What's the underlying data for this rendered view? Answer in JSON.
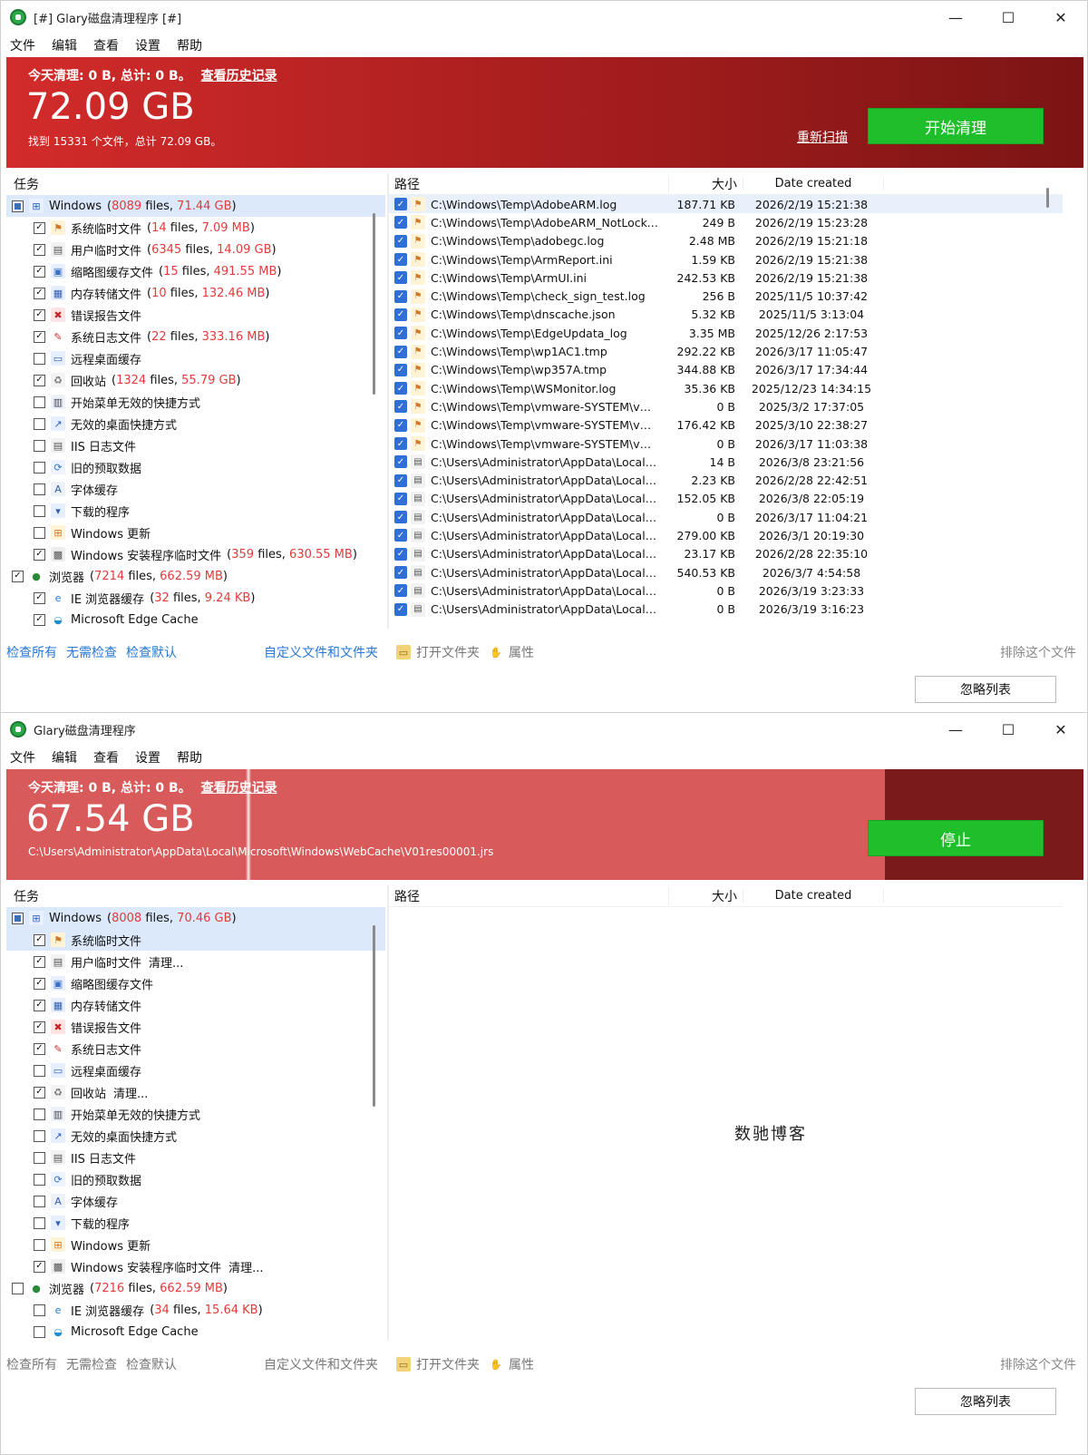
{
  "menu": [
    "文件",
    "编辑",
    "查看",
    "设置",
    "帮助"
  ],
  "window1": {
    "title": "[#] Glary磁盘清理程序 [#]",
    "banner": {
      "today": "今天清理: 0 B, 总计: 0 B。",
      "history": "查看历史记录",
      "big": "72.09 GB",
      "sub": "找到 15331 个文件，总计 72.09 GB。",
      "rescan": "重新扫描",
      "action": "开始清理"
    },
    "tasks_header": "任务",
    "tree": [
      {
        "check": "tri",
        "name": "Windows",
        "files": "8089",
        "size": "71.44 GB",
        "level": 0,
        "icon": "windows-icon",
        "sel": true
      },
      {
        "check": "on",
        "name": "系统临时文件",
        "files": "14",
        "size": "7.09 MB",
        "level": 1,
        "icon": "windows-flag-icon"
      },
      {
        "check": "on",
        "name": "用户临时文件",
        "files": "6345",
        "size": "14.09 GB",
        "level": 1,
        "icon": "user-file-icon"
      },
      {
        "check": "on",
        "name": "缩略图缓存文件",
        "files": "15",
        "size": "491.55 MB",
        "level": 1,
        "icon": "thumbnail-icon"
      },
      {
        "check": "on",
        "name": "内存转储文件",
        "files": "10",
        "size": "132.46 MB",
        "level": 1,
        "icon": "memory-dump-icon"
      },
      {
        "check": "on",
        "name": "错误报告文件",
        "files": "",
        "size": "",
        "level": 1,
        "icon": "error-report-icon"
      },
      {
        "check": "on",
        "name": "系统日志文件",
        "files": "22",
        "size": "333.16 MB",
        "level": 1,
        "icon": "system-log-icon"
      },
      {
        "check": "off",
        "name": "远程桌面缓存",
        "files": "",
        "size": "",
        "level": 1,
        "icon": "remote-desktop-icon"
      },
      {
        "check": "on",
        "name": "回收站",
        "files": "1324",
        "size": "55.79 GB",
        "level": 1,
        "icon": "recycle-bin-icon"
      },
      {
        "check": "off",
        "name": "开始菜单无效的快捷方式",
        "files": "",
        "size": "",
        "level": 1,
        "icon": "start-menu-icon"
      },
      {
        "check": "off",
        "name": "无效的桌面快捷方式",
        "files": "",
        "size": "",
        "level": 1,
        "icon": "desktop-shortcut-icon"
      },
      {
        "check": "off",
        "name": "IIS 日志文件",
        "files": "",
        "size": "",
        "level": 1,
        "icon": "iis-log-icon"
      },
      {
        "check": "off",
        "name": "旧的预取数据",
        "files": "",
        "size": "",
        "level": 1,
        "icon": "prefetch-icon"
      },
      {
        "check": "off",
        "name": "字体缓存",
        "files": "",
        "size": "",
        "level": 1,
        "icon": "font-cache-icon"
      },
      {
        "check": "off",
        "name": "下载的程序",
        "files": "",
        "size": "",
        "level": 1,
        "icon": "downloaded-program-icon"
      },
      {
        "check": "off",
        "name": "Windows 更新",
        "files": "",
        "size": "",
        "level": 1,
        "icon": "windows-update-icon"
      },
      {
        "check": "on",
        "name": "Windows 安装程序临时文件",
        "files": "359",
        "size": "630.55 MB",
        "level": 1,
        "icon": "installer-temp-icon"
      },
      {
        "check": "on",
        "name": "浏览器",
        "files": "7214",
        "size": "662.59 MB",
        "level": 0,
        "icon": "globe-icon"
      },
      {
        "check": "on",
        "name": "IE 浏览器缓存",
        "files": "32",
        "size": "9.24 KB",
        "level": 1,
        "icon": "ie-icon"
      },
      {
        "check": "on",
        "name": "Microsoft Edge Cache",
        "files": "",
        "size": "",
        "level": 1,
        "icon": "edge-icon"
      }
    ],
    "columns": {
      "path": "路径",
      "size": "大小",
      "date": "Date created"
    },
    "files": [
      {
        "path": "C:\\Windows\\Temp\\AdobeARM.log",
        "size": "187.71 KB",
        "date": "2026/2/19 15:21:38",
        "icon": "windows-flag-icon"
      },
      {
        "path": "C:\\Windows\\Temp\\AdobeARM_NotLocke...",
        "size": "249 B",
        "date": "2026/2/19 15:23:28",
        "icon": "windows-flag-icon"
      },
      {
        "path": "C:\\Windows\\Temp\\adobegc.log",
        "size": "2.48 MB",
        "date": "2026/2/19 15:21:18",
        "icon": "windows-flag-icon"
      },
      {
        "path": "C:\\Windows\\Temp\\ArmReport.ini",
        "size": "1.59 KB",
        "date": "2026/2/19 15:21:38",
        "icon": "windows-flag-icon"
      },
      {
        "path": "C:\\Windows\\Temp\\ArmUI.ini",
        "size": "242.53 KB",
        "date": "2026/2/19 15:21:38",
        "icon": "windows-flag-icon"
      },
      {
        "path": "C:\\Windows\\Temp\\check_sign_test.log",
        "size": "256 B",
        "date": "2025/11/5 10:37:42",
        "icon": "windows-flag-icon"
      },
      {
        "path": "C:\\Windows\\Temp\\dnscache.json",
        "size": "5.32 KB",
        "date": "2025/11/5 3:13:04",
        "icon": "windows-flag-icon"
      },
      {
        "path": "C:\\Windows\\Temp\\EdgeUpdata_log",
        "size": "3.35 MB",
        "date": "2025/12/26 2:17:53",
        "icon": "windows-flag-icon"
      },
      {
        "path": "C:\\Windows\\Temp\\wp1AC1.tmp",
        "size": "292.22 KB",
        "date": "2026/3/17 11:05:47",
        "icon": "windows-flag-icon"
      },
      {
        "path": "C:\\Windows\\Temp\\wp357A.tmp",
        "size": "344.88 KB",
        "date": "2026/3/17 17:34:44",
        "icon": "windows-flag-icon"
      },
      {
        "path": "C:\\Windows\\Temp\\WSMonitor.log",
        "size": "35.36 KB",
        "date": "2025/12/23 14:34:15",
        "icon": "windows-flag-icon"
      },
      {
        "path": "C:\\Windows\\Temp\\vmware-SYSTEM\\vma...",
        "size": "0 B",
        "date": "2025/3/2 17:37:05",
        "icon": "windows-flag-icon"
      },
      {
        "path": "C:\\Windows\\Temp\\vmware-SYSTEM\\vmw...",
        "size": "176.42 KB",
        "date": "2025/3/10 22:38:27",
        "icon": "windows-flag-icon"
      },
      {
        "path": "C:\\Windows\\Temp\\vmware-SYSTEM\\vmw...",
        "size": "0 B",
        "date": "2026/3/17 11:03:38",
        "icon": "windows-flag-icon"
      },
      {
        "path": "C:\\Users\\Administrator\\AppData\\Local\\T...",
        "size": "14 B",
        "date": "2026/3/8 23:21:56",
        "icon": "user-file-icon"
      },
      {
        "path": "C:\\Users\\Administrator\\AppData\\Local\\T...",
        "size": "2.23 KB",
        "date": "2026/2/28 22:42:51",
        "icon": "user-file-icon"
      },
      {
        "path": "C:\\Users\\Administrator\\AppData\\Local\\T...",
        "size": "152.05 KB",
        "date": "2026/3/8 22:05:19",
        "icon": "user-file-icon"
      },
      {
        "path": "C:\\Users\\Administrator\\AppData\\Local\\T...",
        "size": "0 B",
        "date": "2026/3/17 11:04:21",
        "icon": "user-file-icon"
      },
      {
        "path": "C:\\Users\\Administrator\\AppData\\Local\\T...",
        "size": "279.00 KB",
        "date": "2026/3/1 20:19:30",
        "icon": "user-file-icon"
      },
      {
        "path": "C:\\Users\\Administrator\\AppData\\Local\\T...",
        "size": "23.17 KB",
        "date": "2026/2/28 22:35:10",
        "icon": "user-file-icon"
      },
      {
        "path": "C:\\Users\\Administrator\\AppData\\Local\\T...",
        "size": "540.53 KB",
        "date": "2026/3/7 4:54:58",
        "icon": "user-file-icon"
      },
      {
        "path": "C:\\Users\\Administrator\\AppData\\Local\\T...",
        "size": "0 B",
        "date": "2026/3/19 3:23:33",
        "icon": "user-file-icon"
      },
      {
        "path": "C:\\Users\\Administrator\\AppData\\Local\\T...",
        "size": "0 B",
        "date": "2026/3/19 3:16:23",
        "icon": "user-file-icon"
      }
    ]
  },
  "window2": {
    "title": "Glary磁盘清理程序",
    "banner": {
      "today": "今天清理: 0 B, 总计: 0 B。",
      "history": "查看历史记录",
      "big": "67.54 GB",
      "sub": "C:\\Users\\Administrator\\AppData\\Local\\Microsoft\\Windows\\WebCache\\V01res00001.jrs",
      "action": "停止",
      "progress": 0.816
    },
    "tasks_header": "任务",
    "tree": [
      {
        "check": "tri",
        "name": "Windows",
        "files": "8008",
        "size": "70.46 GB",
        "level": 0,
        "icon": "windows-icon",
        "sel": true
      },
      {
        "check": "on",
        "name": "系统临时文件",
        "status": "",
        "level": 1,
        "icon": "windows-flag-icon",
        "sel": true
      },
      {
        "check": "on",
        "name": "用户临时文件",
        "status": "清理...",
        "level": 1,
        "icon": "user-file-icon"
      },
      {
        "check": "on",
        "name": "缩略图缓存文件",
        "status": "",
        "level": 1,
        "icon": "thumbnail-icon"
      },
      {
        "check": "on",
        "name": "内存转储文件",
        "status": "",
        "level": 1,
        "icon": "memory-dump-icon"
      },
      {
        "check": "on",
        "name": "错误报告文件",
        "status": "",
        "level": 1,
        "icon": "error-report-icon"
      },
      {
        "check": "on",
        "name": "系统日志文件",
        "status": "",
        "level": 1,
        "icon": "system-log-icon"
      },
      {
        "check": "off",
        "name": "远程桌面缓存",
        "status": "",
        "level": 1,
        "icon": "remote-desktop-icon"
      },
      {
        "check": "on",
        "name": "回收站",
        "status": "清理...",
        "level": 1,
        "icon": "recycle-bin-icon"
      },
      {
        "check": "off",
        "name": "开始菜单无效的快捷方式",
        "status": "",
        "level": 1,
        "icon": "start-menu-icon"
      },
      {
        "check": "off",
        "name": "无效的桌面快捷方式",
        "status": "",
        "level": 1,
        "icon": "desktop-shortcut-icon"
      },
      {
        "check": "off",
        "name": "IIS 日志文件",
        "status": "",
        "level": 1,
        "icon": "iis-log-icon"
      },
      {
        "check": "off",
        "name": "旧的预取数据",
        "status": "",
        "level": 1,
        "icon": "prefetch-icon"
      },
      {
        "check": "off",
        "name": "字体缓存",
        "status": "",
        "level": 1,
        "icon": "font-cache-icon"
      },
      {
        "check": "off",
        "name": "下载的程序",
        "status": "",
        "level": 1,
        "icon": "downloaded-program-icon"
      },
      {
        "check": "off",
        "name": "Windows 更新",
        "status": "",
        "level": 1,
        "icon": "windows-update-icon"
      },
      {
        "check": "on",
        "name": "Windows 安装程序临时文件",
        "status": "清理...",
        "level": 1,
        "icon": "installer-temp-icon"
      },
      {
        "check": "off",
        "name": "浏览器",
        "files": "7216",
        "size": "662.59 MB",
        "level": 0,
        "icon": "globe-icon"
      },
      {
        "check": "off",
        "name": "IE 浏览器缓存",
        "files": "34",
        "size": "15.64 KB",
        "level": 1,
        "icon": "ie-icon"
      },
      {
        "check": "off",
        "name": "Microsoft Edge Cache",
        "level": 1,
        "icon": "edge-icon"
      }
    ],
    "columns": {
      "path": "路径",
      "size": "大小",
      "date": "Date created"
    },
    "watermark": "数驰博客"
  },
  "toolbar": {
    "check_all": "检查所有",
    "check_none": "无需检查",
    "check_default": "检查默认",
    "custom": "自定义文件和文件夹",
    "open_folder": "打开文件夹",
    "properties": "属性",
    "exclude": "排除这个文件",
    "ignore_list": "忽略列表"
  },
  "window_controls": {
    "minimize": "—",
    "maximize": "☐",
    "close": "✕"
  }
}
